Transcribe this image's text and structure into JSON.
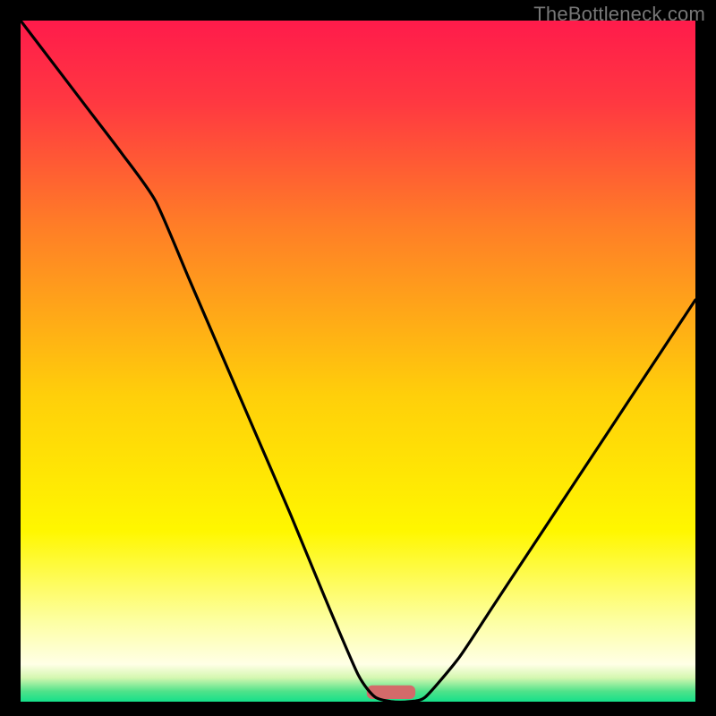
{
  "attribution": "TheBottleneck.com",
  "chart_data": {
    "type": "line",
    "title": "",
    "xlabel": "",
    "ylabel": "",
    "xlim": [
      0,
      100
    ],
    "ylim": [
      0,
      100
    ],
    "x": [
      0,
      5,
      10,
      15,
      20,
      25,
      30,
      35,
      40,
      45,
      50,
      52.5,
      55,
      57.5,
      60,
      65,
      70,
      75,
      80,
      85,
      90,
      95,
      100
    ],
    "values": [
      100,
      93.5,
      87,
      80.5,
      73.5,
      62,
      50.5,
      39,
      27.5,
      15.5,
      4,
      0.7,
      0,
      0,
      0.7,
      6.5,
      14,
      21.5,
      29,
      36.5,
      44,
      51.5,
      59
    ],
    "background_gradient": {
      "stops": [
        {
          "offset": 0.0,
          "color": "#ff1b4b"
        },
        {
          "offset": 0.12,
          "color": "#ff3841"
        },
        {
          "offset": 0.3,
          "color": "#ff7d27"
        },
        {
          "offset": 0.55,
          "color": "#ffcf0a"
        },
        {
          "offset": 0.75,
          "color": "#fff700"
        },
        {
          "offset": 0.88,
          "color": "#fdffa0"
        },
        {
          "offset": 0.945,
          "color": "#ffffe6"
        },
        {
          "offset": 0.965,
          "color": "#d4f7b0"
        },
        {
          "offset": 0.985,
          "color": "#4fe28a"
        },
        {
          "offset": 1.0,
          "color": "#15e08a"
        }
      ]
    },
    "marker": {
      "x_start": 51.3,
      "x_end": 58.5,
      "y": 0.4,
      "color": "#d36a6a",
      "height_pct": 2.0
    }
  }
}
